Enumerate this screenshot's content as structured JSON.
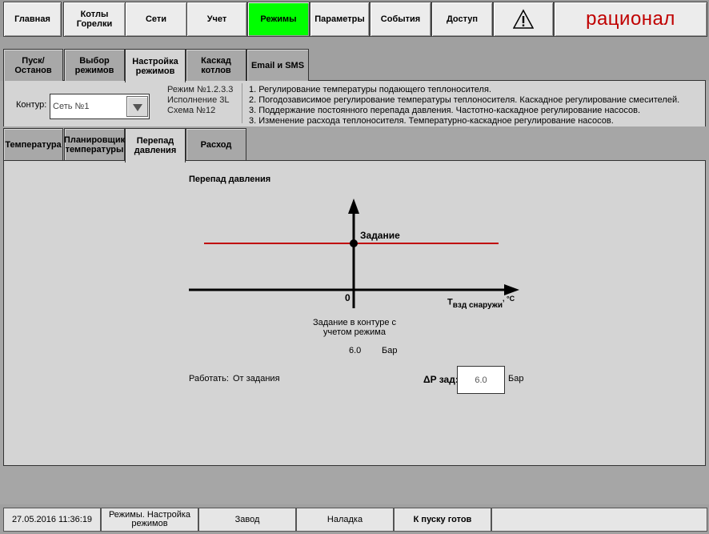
{
  "topnav": {
    "items": [
      {
        "label": "Главная"
      },
      {
        "label": "Котлы\nГорелки"
      },
      {
        "label": "Сети"
      },
      {
        "label": "Учет"
      },
      {
        "label": "Режимы"
      },
      {
        "label": "Параметры"
      },
      {
        "label": "События"
      },
      {
        "label": "Доступ"
      }
    ],
    "brand": "рационал",
    "active_color": "#00ff00"
  },
  "mode_tabs": [
    {
      "label": "Пуск/Останов"
    },
    {
      "label": "Выбор\nрежимов"
    },
    {
      "label": "Настройка\nрежимов"
    },
    {
      "label": "Каскад\nкотлов"
    },
    {
      "label": "Email и SMS"
    }
  ],
  "contour": {
    "label": "Контур:",
    "value": "Сеть №1"
  },
  "mode_info": {
    "mode": "Режим №1.2.3.3",
    "execution": "Исполнение 3L",
    "scheme": "Схема №12"
  },
  "descriptions": [
    "1. Регулирование температуры подающего теплоносителя.",
    "2. Погодозависимое регулирование температуры теплоносителя. Каскадное регулирование смесителей.",
    "3. Поддержание постоянного перепада давления. Частотно-каскадное регулирование насосов.",
    "3. Изменение расхода теплоносителя. Температурно-каскадное регулирование насосов."
  ],
  "sub_tabs": [
    {
      "label": "Температура"
    },
    {
      "label": "Планировщик\nтемпературы"
    },
    {
      "label": "Перепад\nдавления"
    },
    {
      "label": "Расход"
    }
  ],
  "panel": {
    "title": "Перепад давления",
    "graph": {
      "setpoint_label": "Задание",
      "origin_label": "0",
      "x_axis_label": "T",
      "x_axis_subscript": "взд снаружи",
      "x_axis_unit": ", °C",
      "setpoint_line_color": "#c00000"
    },
    "contour_setpoint_caption": "Задание в контуре с учетом режима",
    "contour_setpoint_value": "6.0",
    "contour_setpoint_unit": "Бар",
    "work_label": "Работать:",
    "work_value": "От задания",
    "dp_label": "ΔP зад:",
    "dp_value": "6.0",
    "dp_unit": "Бар"
  },
  "statusbar": {
    "datetime": "27.05.2016 11:36:19",
    "screen": "Режимы. Настройка\nрежимов",
    "site": "Завод",
    "mode": "Наладка",
    "ready": "К пуску готов"
  }
}
